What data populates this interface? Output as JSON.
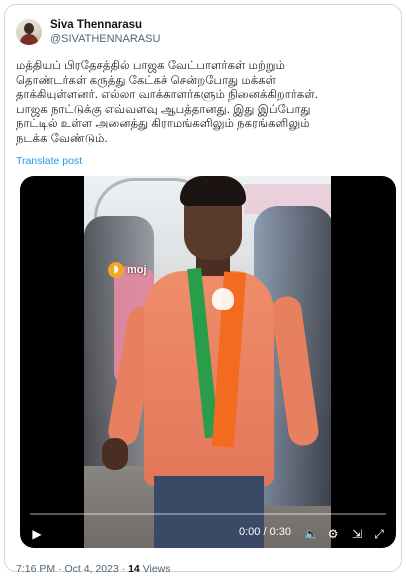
{
  "post": {
    "author": {
      "display_name": "Siva Thennarasu",
      "handle": "@SIVATHENNARASU"
    },
    "text": "மத்தியப் பிரதேசத்தில் பாஜக வேட்பாளர்கள் மற்றும்\nதொண்டர்கள் கருத்து கேட்கச் சென்றபோது மக்கள்\nதாக்கியுள்ளனர். எல்லா வாக்காளர்களும் நினைக்கிறார்கள்.\nபாஜக நாட்டுக்கு எவ்வளவு ஆபத்தானது. இது இப்போது\nநாட்டில் உள்ள அனைத்து கிராமங்களிலும் நகரங்களிலும்\nநடக்க வேண்டும்.",
    "translate_label": "Translate post",
    "video": {
      "watermark": "moj",
      "watermark_icon": "moj-logo-icon",
      "time_label": "0:00 / 0:30",
      "progress": 0
    },
    "footer": {
      "time": "7:16 PM",
      "separator": " · ",
      "date": "Oct 4, 2023",
      "views_count": "14",
      "views_label": " Views"
    }
  },
  "colors": {
    "link": "#1d9bf0",
    "secondary_text": "#536471",
    "border": "#cfd9de"
  }
}
